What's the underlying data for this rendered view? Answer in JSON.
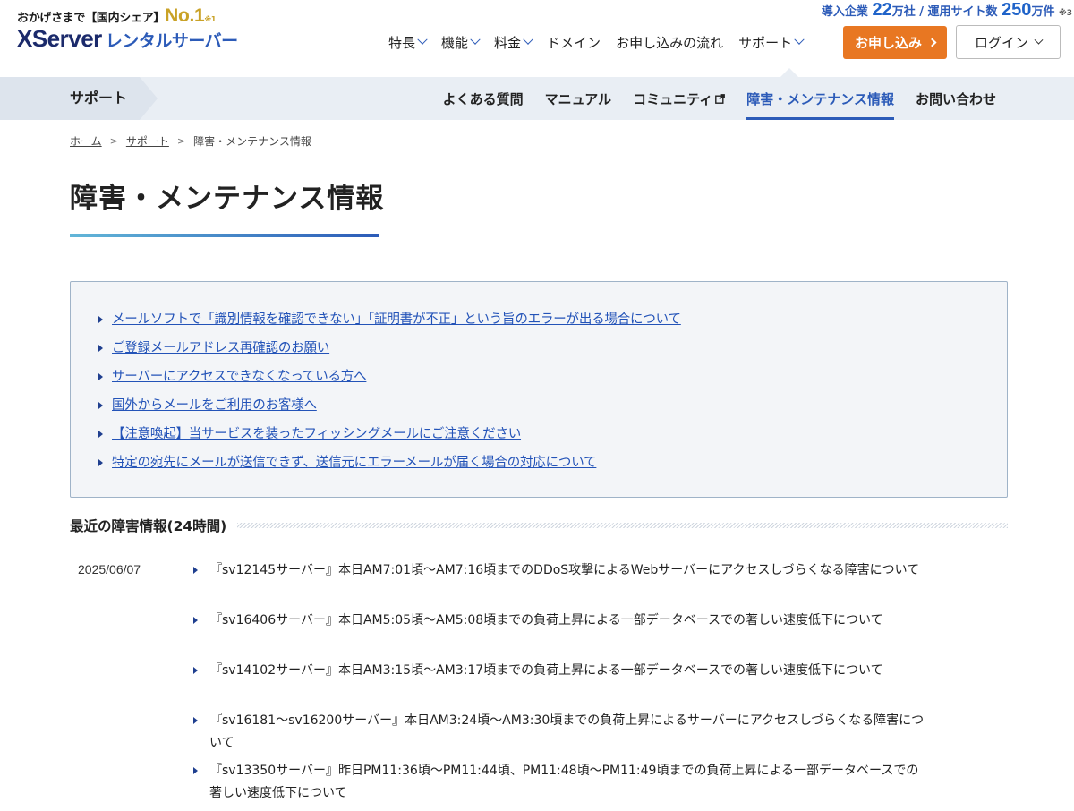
{
  "header": {
    "tagline_prefix": "おかげさまで【国内シェア】",
    "tagline_no1": "No.1",
    "tagline_note": "※1",
    "logo_main": "XServer",
    "logo_sub": "レンタルサーバー",
    "stats_prefix": "導入企業",
    "stats_companies": "22",
    "stats_mid": "万社 / 運用サイト数",
    "stats_sites": "250",
    "stats_suffix": "万件",
    "stats_note": "※3",
    "nav": [
      {
        "label": "特長",
        "dropdown": true
      },
      {
        "label": "機能",
        "dropdown": true
      },
      {
        "label": "料金",
        "dropdown": true
      },
      {
        "label": "ドメイン",
        "dropdown": false
      },
      {
        "label": "お申し込みの流れ",
        "dropdown": false
      },
      {
        "label": "サポート",
        "dropdown": true
      }
    ],
    "apply_label": "お申し込み",
    "login_label": "ログイン"
  },
  "subnav": {
    "title": "サポート",
    "links": [
      {
        "label": "よくある質問",
        "active": false,
        "external": false
      },
      {
        "label": "マニュアル",
        "active": false,
        "external": false
      },
      {
        "label": "コミュニティ",
        "active": false,
        "external": true
      },
      {
        "label": "障害・メンテナンス情報",
        "active": true,
        "external": false
      },
      {
        "label": "お問い合わせ",
        "active": false,
        "external": false
      }
    ]
  },
  "breadcrumb": {
    "home": "ホーム",
    "support": "サポート",
    "current": "障害・メンテナンス情報",
    "separator": ">"
  },
  "page_title": "障害・メンテナンス情報",
  "notices": [
    "メールソフトで「識別情報を確認できない」「証明書が不正」という旨のエラーが出る場合について",
    "ご登録メールアドレス再確認のお願い",
    "サーバーにアクセスできなくなっている方へ",
    "国外からメールをご利用のお客様へ",
    "【注意喚起】当サービスを装ったフィッシングメールにご注意ください",
    "特定の宛先にメールが送信できず、送信元にエラーメールが届く場合の対応について"
  ],
  "recent": {
    "heading": "最近の障害情報(24時間)",
    "date": "2025/06/07",
    "items": [
      "『sv12145サーバー』本日AM7:01頃～AM7:16頃までのDDoS攻撃によるWebサーバーにアクセスしづらくなる障害について",
      "『sv16406サーバー』本日AM5:05頃～AM5:08頃までの負荷上昇による一部データベースでの著しい速度低下について",
      "『sv14102サーバー』本日AM3:15頃～AM3:17頃までの負荷上昇による一部データベースでの著しい速度低下について",
      "『sv16181～sv16200サーバー』本日AM3:24頃～AM3:30頃までの負荷上昇によるサーバーにアクセスしづらくなる障害について",
      "『sv13350サーバー』昨日PM11:36頃～PM11:44頃、PM11:48頃～PM11:49頃までの負荷上昇による一部データベースでの著しい速度低下について"
    ]
  },
  "colors": {
    "accent_blue": "#2c5bb8",
    "apply_orange": "#e87722",
    "gold": "#c9a227",
    "subnav_bg": "#e9eef4",
    "link_blue": "#2353b8"
  },
  "icons": {
    "nav_dropdown": "chevron-down-icon",
    "apply_arrow": "chevron-right-icon",
    "community_external": "external-link-icon",
    "list_bullet": "triangle-right-icon"
  }
}
